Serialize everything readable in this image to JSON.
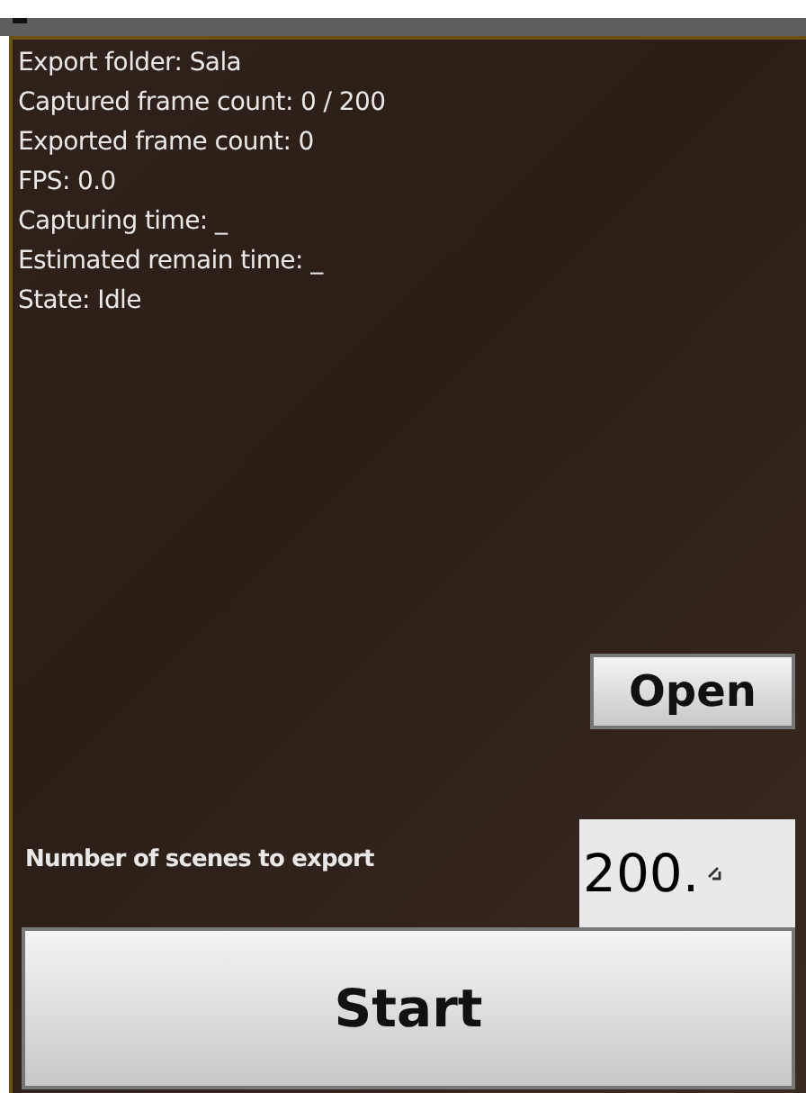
{
  "status_lines": [
    "Export folder: Sala",
    "Captured frame count: 0 / 200",
    "Exported frame count: 0",
    "FPS: 0.0",
    "Capturing time: _",
    "Estimated remain time: _",
    "State: Idle"
  ],
  "open_button": {
    "label": "Open"
  },
  "scenes_field": {
    "label": "Number of scenes to export",
    "value": "200."
  },
  "start_button": {
    "label": "Start"
  }
}
